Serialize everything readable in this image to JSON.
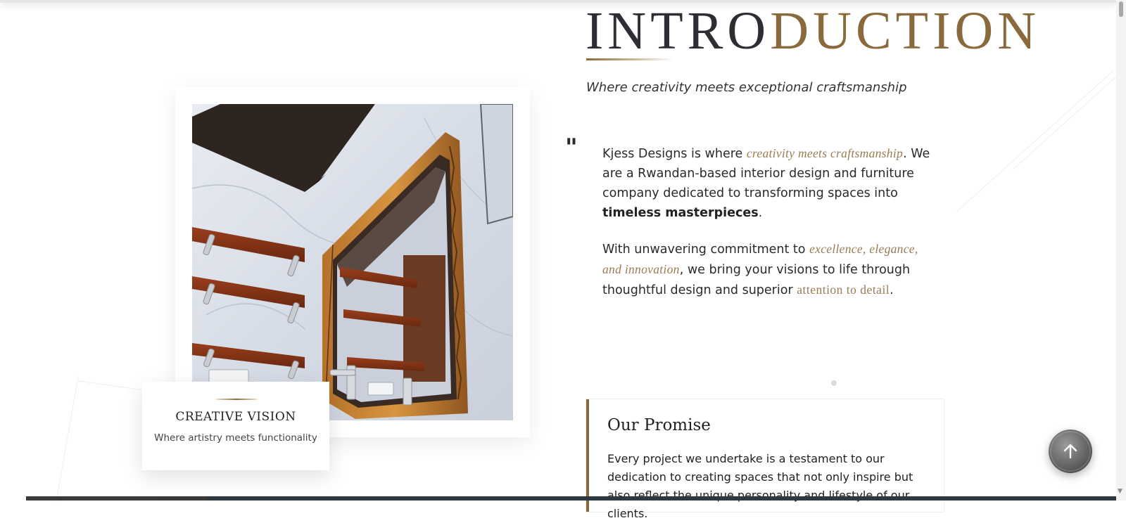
{
  "intro": {
    "title_part1": "INTRO",
    "title_part2": "DUCTION",
    "tagline": "Where creativity meets exceptional craftsmanship"
  },
  "about": {
    "quote_mark": "\"",
    "p1_text1": "Kjess Designs is where ",
    "p1_accent": "creativity meets craftsmanship",
    "p1_text2": ". We are a Rwandan-based interior design and furniture company dedicated to transforming spaces into ",
    "p1_strong": "timeless masterpieces",
    "p1_text3": ".",
    "p2_text1": "With unwavering commitment to ",
    "p2_accent1": "excellence, elegance, and innovation",
    "p2_text2": ", we bring your visions to life through thoughtful design and superior ",
    "p2_accent2": "attention to detail",
    "p2_text3": "."
  },
  "image_card": {
    "alt": "Bathroom with wooden floating shelves and carved wooden framed mirror",
    "vision_title": "CREATIVE VISION",
    "vision_subtitle": "Where artistry meets functionality"
  },
  "promise": {
    "title": "Our Promise",
    "text": "Every project we undertake is a testament to our dedication to creating spaces that not only inspire but also reflect the unique personality and lifestyle of our clients."
  },
  "scroll_top": {
    "icon": "arrow-up-icon"
  },
  "colors": {
    "accent": "#8a6a3c",
    "accent_text": "#9a7b52",
    "dark": "#2d2d33"
  }
}
